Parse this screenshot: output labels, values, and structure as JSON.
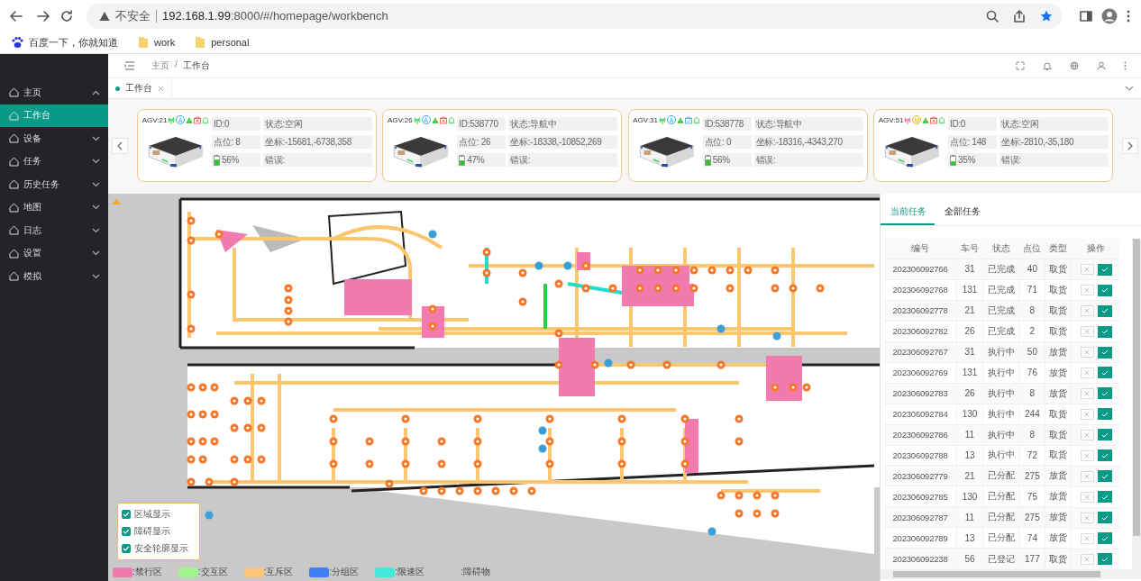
{
  "browser": {
    "security": "不安全",
    "url_host": "192.168.1.99",
    "url_rest": ":8000/#/homepage/workbench",
    "bookmarks": [
      {
        "label": "百度一下，你就知道",
        "kind": "site"
      },
      {
        "label": "work",
        "kind": "folder"
      },
      {
        "label": "personal",
        "kind": "folder"
      }
    ]
  },
  "sidebar": {
    "items": [
      {
        "label": "主页",
        "expanded": true,
        "selected": false,
        "children": [
          {
            "label": "工作台",
            "selected": true
          }
        ]
      },
      {
        "label": "设备",
        "expanded": false,
        "selected": false
      },
      {
        "label": "任务",
        "expanded": false,
        "selected": false
      },
      {
        "label": "历史任务",
        "expanded": false,
        "selected": false
      },
      {
        "label": "地图",
        "expanded": false,
        "selected": false
      },
      {
        "label": "日志",
        "expanded": false,
        "selected": false
      },
      {
        "label": "设置",
        "expanded": false,
        "selected": false
      },
      {
        "label": "模拟",
        "expanded": false,
        "selected": false
      }
    ]
  },
  "breadcrumb": [
    "主页",
    "工作台"
  ],
  "breadcrumb_separator": "/",
  "page_tabs": [
    {
      "label": "工作台",
      "selected": true
    }
  ],
  "agvs": [
    {
      "name": "AGV:21",
      "signal_ok": true,
      "mode": "A",
      "mode_auto": true,
      "cargo_error": true,
      "id": "ID:0",
      "state": "状态:空闲",
      "point": "点位: 8",
      "coords": "坐标:-15681,-6738,358",
      "level": 0.56,
      "battery": "56%",
      "error": "错误:"
    },
    {
      "name": "AGV:26",
      "signal_ok": true,
      "mode": "A",
      "mode_auto": true,
      "cargo_error": true,
      "id": "ID:538770",
      "state": "状态:导航中",
      "point": "点位: 26",
      "coords": "坐标:-18338,-10852,269",
      "level": 0.47,
      "battery": "47%",
      "error": "错误:"
    },
    {
      "name": "AGV:31",
      "signal_ok": true,
      "mode": "A",
      "mode_auto": true,
      "cargo_error": false,
      "id": "ID:538778",
      "state": "状态:导航中",
      "point": "点位: 0",
      "coords": "坐标:-18316,-4343,270",
      "level": 0.56,
      "battery": "56%",
      "error": "错误:"
    },
    {
      "name": "AGV:51",
      "signal_ok": false,
      "mode": "M",
      "mode_auto": false,
      "cargo_error": true,
      "id": "ID:0",
      "state": "状态:空闲",
      "point": "点位: 148",
      "coords": "坐标:-2810,-35,180",
      "level": 0.35,
      "battery": "35%",
      "error": "错误:"
    }
  ],
  "map_options": [
    {
      "label": "区域显示",
      "checked": true
    },
    {
      "label": "障碍显示",
      "checked": true
    },
    {
      "label": "安全轮廓显示",
      "checked": true
    }
  ],
  "legend": [
    {
      "label": ":禁行区",
      "color": "#f37aaf"
    },
    {
      "label": ":交互区",
      "color": "#9ef58c"
    },
    {
      "label": ":互斥区",
      "color": "#fcc67a"
    },
    {
      "label": ":分组区",
      "color": "#3f7ef5"
    },
    {
      "label": ":限速区",
      "color": "#42e8da"
    },
    {
      "label": ":障碍物"
    }
  ],
  "task_tabs": [
    {
      "label": "当前任务",
      "selected": true
    },
    {
      "label": "全部任务",
      "selected": false
    }
  ],
  "task_table": {
    "columns": [
      "编号",
      "车号",
      "状态",
      "点位",
      "类型",
      "操作"
    ],
    "rows": [
      [
        "202306092766",
        "31",
        "已完成",
        "40",
        "取货"
      ],
      [
        "202306092768",
        "131",
        "已完成",
        "71",
        "取货"
      ],
      [
        "202306092778",
        "21",
        "已完成",
        "8",
        "取货"
      ],
      [
        "202306092782",
        "26",
        "已完成",
        "2",
        "取货"
      ],
      [
        "202306092767",
        "31",
        "执行中",
        "50",
        "放货"
      ],
      [
        "202306092769",
        "131",
        "执行中",
        "76",
        "放货"
      ],
      [
        "202306092783",
        "26",
        "执行中",
        "8",
        "放货"
      ],
      [
        "202306092784",
        "130",
        "执行中",
        "244",
        "取货"
      ],
      [
        "202306092786",
        "11",
        "执行中",
        "8",
        "取货"
      ],
      [
        "202306092788",
        "13",
        "执行中",
        "72",
        "取货"
      ],
      [
        "202306092779",
        "21",
        "已分配",
        "275",
        "放货"
      ],
      [
        "202306092785",
        "130",
        "已分配",
        "75",
        "放货"
      ],
      [
        "202306092787",
        "11",
        "已分配",
        "275",
        "放货"
      ],
      [
        "202306092789",
        "13",
        "已分配",
        "74",
        "放货"
      ],
      [
        "202306092238",
        "56",
        "已登记",
        "177",
        "取货"
      ]
    ]
  }
}
